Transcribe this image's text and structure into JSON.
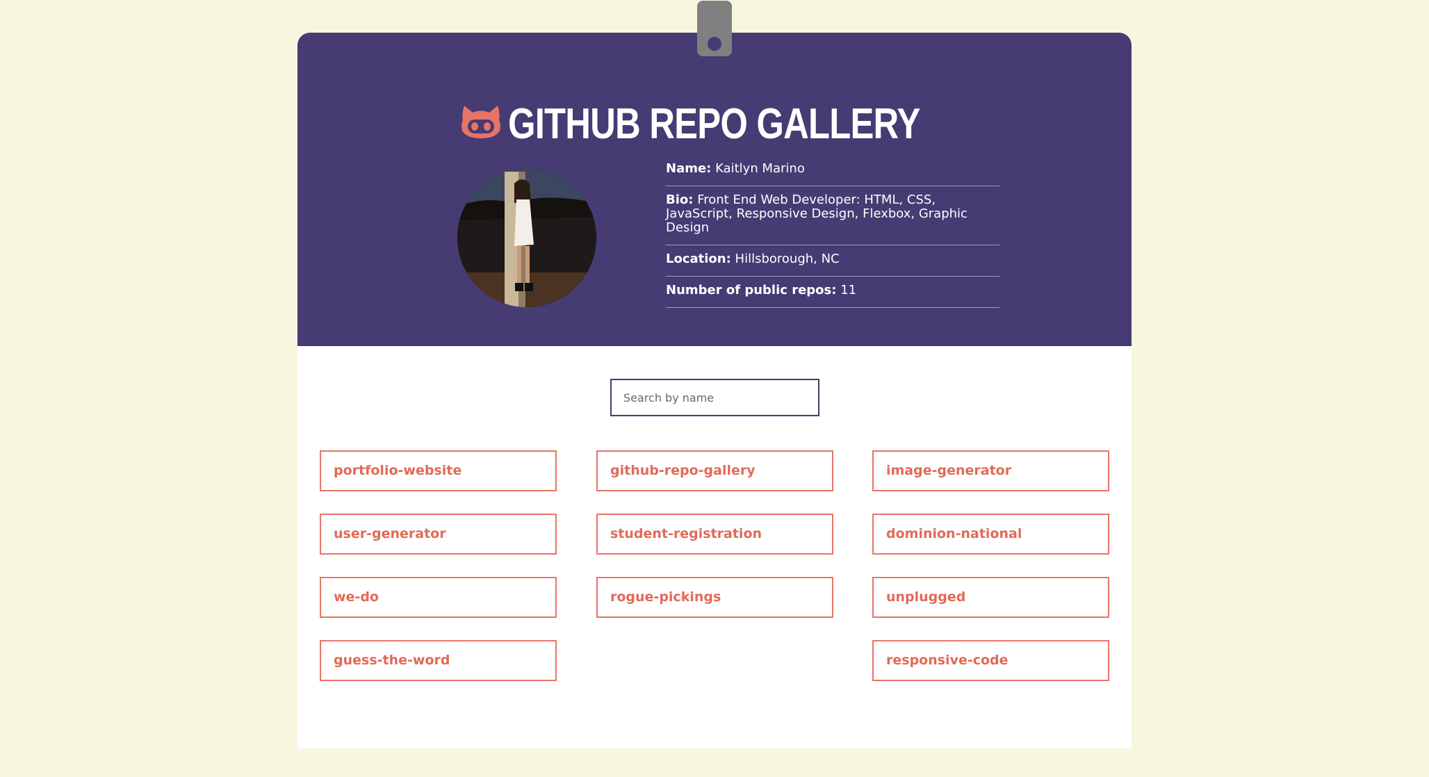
{
  "header": {
    "title": "GITHUB REPO GALLERY",
    "logo_icon": "github-octocat-icon"
  },
  "profile": {
    "avatar_icon": "user-avatar-photo",
    "name_label": "Name:",
    "name_value": "Kaitlyn Marino",
    "bio_label": "Bio:",
    "bio_value": "Front End Web Developer: HTML, CSS, JavaScript, Responsive Design, Flexbox, Graphic Design",
    "location_label": "Location:",
    "location_value": "Hillsborough, NC",
    "repos_label": "Number of public repos:",
    "repos_value": "11"
  },
  "search": {
    "placeholder": "Search by name"
  },
  "repos": [
    "portfolio-website",
    "github-repo-gallery",
    "image-generator",
    "user-generator",
    "student-registration",
    "dominion-national",
    "we-do",
    "rogue-pickings",
    "unplugged",
    "guess-the-word",
    "responsive-code"
  ],
  "colors": {
    "page_background": "#f9f6df",
    "header_background": "#463b73",
    "accent": "#e77466",
    "clip": "#808080"
  }
}
